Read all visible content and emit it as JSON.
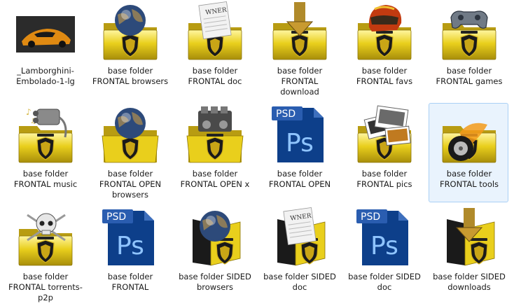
{
  "colors": {
    "folder_yellow": "#e9cf1c",
    "folder_dark": "#a88e0a",
    "ps_blue": "#0d3f8a",
    "ps_text": "#8fc4ff",
    "selection_bg": "#e9f3fd",
    "selection_border": "#a9d0f5"
  },
  "items": [
    {
      "label": "_Lamborghini-Embolado-1-lg",
      "icon": "car-photo",
      "kind": "image"
    },
    {
      "label": "base folder FRONTAL browsers",
      "icon": "globe-icon",
      "kind": "front"
    },
    {
      "label": "base folder FRONTAL doc",
      "icon": "document-icon",
      "kind": "front"
    },
    {
      "label": "base folder FRONTAL download",
      "icon": "download-arrow-icon",
      "kind": "front"
    },
    {
      "label": "base folder FRONTAL favs",
      "icon": "helmet-icon",
      "kind": "front"
    },
    {
      "label": "base folder FRONTAL games",
      "icon": "gamepad-icon",
      "kind": "front"
    },
    {
      "label": "base folder FRONTAL music",
      "icon": "music-icon",
      "kind": "front"
    },
    {
      "label": "base folder FRONTAL OPEN browsers",
      "icon": "globe-icon",
      "kind": "open"
    },
    {
      "label": "base folder FRONTAL OPEN x",
      "icon": "engine-icon",
      "kind": "open"
    },
    {
      "label": "base folder FRONTAL OPEN",
      "icon": "psd-icon",
      "kind": "psd"
    },
    {
      "label": "base folder FRONTAL pics",
      "icon": "photos-icon",
      "kind": "front"
    },
    {
      "label": "base folder FRONTAL tools",
      "icon": "wheel-icon",
      "kind": "front",
      "selected": true
    },
    {
      "label": "base folder FRONTAL torrents-p2p",
      "icon": "skull-icon",
      "kind": "front"
    },
    {
      "label": "base folder FRONTAL",
      "icon": "psd-icon",
      "kind": "psd"
    },
    {
      "label": "base folder SIDED browsers",
      "icon": "globe-icon",
      "kind": "sided"
    },
    {
      "label": "base folder SIDED doc",
      "icon": "document-icon",
      "kind": "sided"
    },
    {
      "label": "base folder SIDED doc",
      "icon": "psd-icon",
      "kind": "psd"
    },
    {
      "label": "base folder SIDED downloads",
      "icon": "download-arrow-icon",
      "kind": "sided"
    }
  ],
  "psd_badge": "PSD",
  "ps_letters": "Ps"
}
